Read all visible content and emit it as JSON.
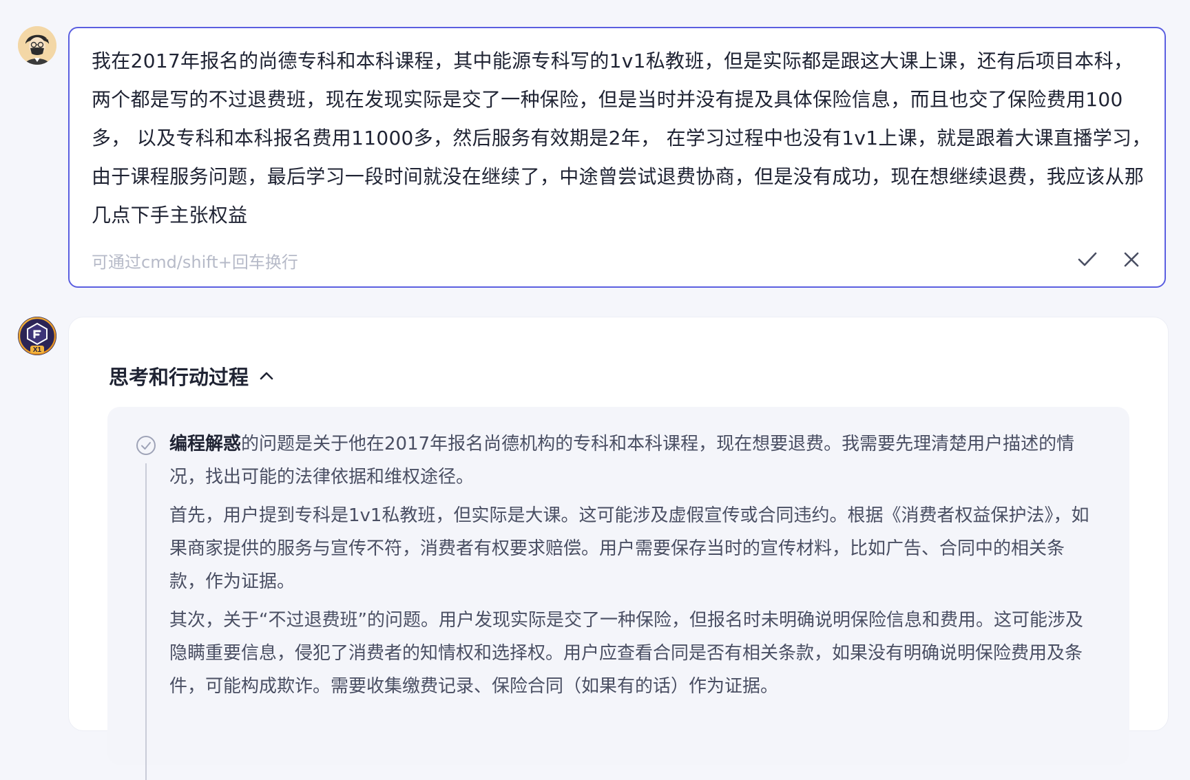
{
  "user_message": {
    "text": "我在2017年报名的尚德专科和本科课程，其中能源专科写的1v1私教班，但是实际都是跟这大课上课，还有后项目本科，两个都是写的不过退费班，现在发现实际是交了一种保险，但是当时并没有提及具体保险信息，而且也交了保险费用100多， 以及专科和本科报名费用11000多，然后服务有效期是2年， 在学习过程中也没有1v1上课，就是跟着大课直播学习，由于课程服务问题，最后学习一段时间就没在继续了，中途曾尝试退费协商，但是没有成功，现在想继续退费，我应该从那几点下手主张权益",
    "hint": "可通过cmd/shift+回车换行",
    "confirm_icon": "check-icon",
    "cancel_icon": "close-icon"
  },
  "bot_avatar_label": "X1",
  "thinking": {
    "header": "思考和行动过程",
    "toggle_icon": "chevron-up-icon",
    "step_icon": "check-circle-icon",
    "bold_lead": "编程解惑",
    "para1_rest": "的问题是关于他在2017年报名尚德机构的专科和本科课程，现在想要退费。我需要先理清楚用户描述的情况，找出可能的法律依据和维权途径。",
    "para2": "首先，用户提到专科是1v1私教班，但实际是大课。这可能涉及虚假宣传或合同违约。根据《消费者权益保护法》，如果商家提供的服务与宣传不符，消费者有权要求赔偿。用户需要保存当时的宣传材料，比如广告、合同中的相关条款，作为证据。",
    "para3": "其次，关于“不过退费班”的问题。用户发现实际是交了一种保险，但报名时未明确说明保险信息和费用。这可能涉及隐瞒重要信息，侵犯了消费者的知情权和选择权。用户应查看合同是否有相关条款，如果没有明确说明保险费用及条件，可能构成欺诈。需要收集缴费记录、保险合同（如果有的话）作为证据。"
  },
  "colors": {
    "accent": "#5a5ee0",
    "page_bg": "#f5f6fb",
    "panel_bg": "#f4f5fa"
  }
}
